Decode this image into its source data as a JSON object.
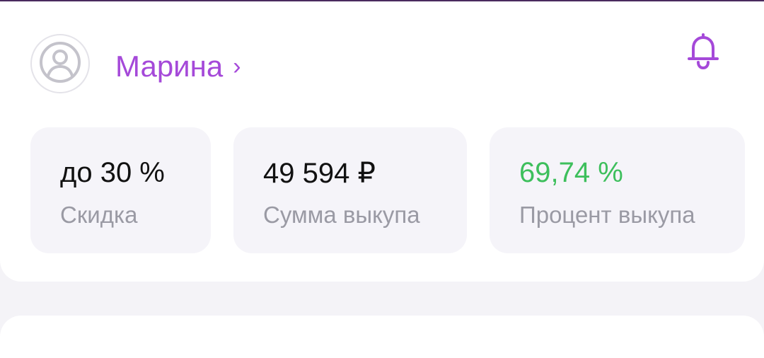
{
  "profile": {
    "avatar_icon": "user-circle-icon",
    "name": "Марина",
    "chevron": "›",
    "notifications_icon": "bell-icon",
    "accent_color": "#a549d9"
  },
  "stats": [
    {
      "value": "до 30 %",
      "label": "Скидка"
    },
    {
      "value": "49 594 ₽",
      "label": "Сумма выкупа"
    },
    {
      "value": "69,74 %",
      "label": "Процент выкупа",
      "value_color": "#3dbf5c"
    }
  ]
}
